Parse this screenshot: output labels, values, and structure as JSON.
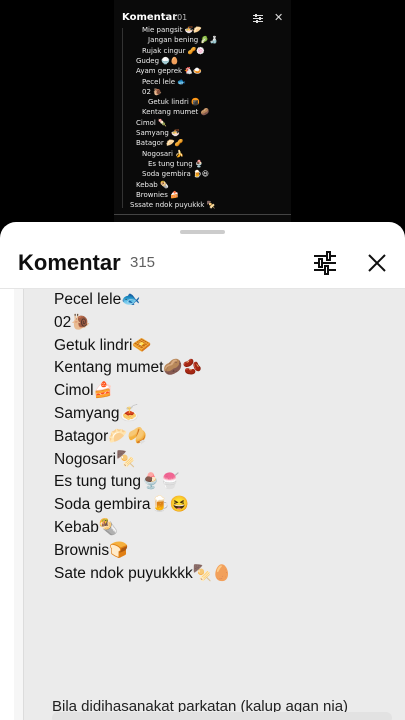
{
  "video": {
    "title": "Komentar",
    "count": "101",
    "lines": [
      {
        "text": "Mie pangsit 🍜🥟",
        "indent": 3
      },
      {
        "text": "Jangan bening 🥬🍶",
        "indent": 4
      },
      {
        "text": "Rujak cingur 🥜🍥",
        "indent": 3
      },
      {
        "text": "Gudeg 🍚🥚",
        "indent": 2
      },
      {
        "text": "Ayam geprek 🐔🍛",
        "indent": 2
      },
      {
        "text": "Pecel lele 🐟",
        "indent": 3
      },
      {
        "text": "02 🐌",
        "indent": 3
      },
      {
        "text": "Getuk lindri 🍘",
        "indent": 4
      },
      {
        "text": "Kentang mumet 🥔",
        "indent": 3
      },
      {
        "text": "Cimol 🍡",
        "indent": 2
      },
      {
        "text": "Samyang 🍜",
        "indent": 2
      },
      {
        "text": "Batagor 🥟🥜",
        "indent": 2
      },
      {
        "text": "Nogosari 🍌",
        "indent": 3
      },
      {
        "text": "Es tung tung 🍨",
        "indent": 4
      },
      {
        "text": "Soda gembira 🍺😆",
        "indent": 3
      },
      {
        "text": "Kebab 🌯",
        "indent": 2
      },
      {
        "text": "Brownies 🍰",
        "indent": 2
      },
      {
        "text": "Sssate ndok puyukkk 🍢",
        "indent": 1
      }
    ]
  },
  "sheet": {
    "title": "Komentar",
    "count": "315"
  },
  "comments": [
    "Pecel lele🐟",
    "02🐌",
    "Getuk lindri🧇",
    "Kentang mumet🥔🫘",
    "Cimol🍰",
    "Samyang🍝",
    "Batagor🥟🥠",
    "Nogosari🍢",
    "Es tung tung🍨🍧",
    "Soda gembira🍺😆",
    "Kebab🌯",
    "Brownis🍞",
    "Sate ndok puyukkkk🍢🥚"
  ],
  "bottom_text": "Bila didihasanakat parkatan (kalup agan nia)",
  "icons": {
    "filter": "sliders-icon",
    "close": "close-icon"
  }
}
